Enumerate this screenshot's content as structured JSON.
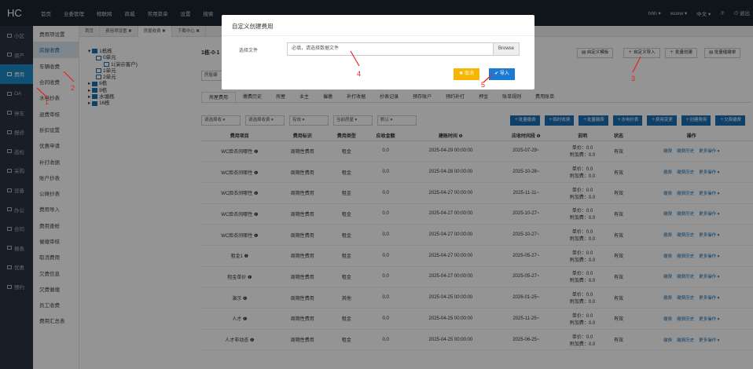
{
  "topbar": {
    "logo": "HC",
    "nav": [
      "首页",
      "业委管理",
      "物联网",
      "商城",
      "常用菜单",
      "设置",
      "搜索"
    ],
    "user": "hhh ▾",
    "community": "wuxw ▾",
    "lang": "中文 ▾",
    "help_icon": "⑦",
    "logout": "退出"
  },
  "sidebar": {
    "items": [
      {
        "label": "小区",
        "active": false
      },
      {
        "label": "资产",
        "active": false
      },
      {
        "label": "费用",
        "active": true
      },
      {
        "label": "OA",
        "active": false
      },
      {
        "label": "停车",
        "active": false
      },
      {
        "label": "报修",
        "active": false
      },
      {
        "label": "巡检",
        "active": false
      },
      {
        "label": "采购",
        "active": false
      },
      {
        "label": "设备",
        "active": false
      },
      {
        "label": "办公",
        "active": false
      },
      {
        "label": "合同",
        "active": false
      },
      {
        "label": "报表",
        "active": false
      },
      {
        "label": "优惠",
        "active": false
      },
      {
        "label": "预约",
        "active": false
      }
    ]
  },
  "submenu": {
    "items": [
      {
        "label": "费用项设置",
        "active": false
      },
      {
        "label": "房屋收费",
        "active": true
      },
      {
        "label": "车辆收费",
        "active": false
      },
      {
        "label": "合同收费",
        "active": false
      },
      {
        "label": "水电抄表",
        "active": false
      },
      {
        "label": "退费审核",
        "active": false
      },
      {
        "label": "折扣设置",
        "active": false
      },
      {
        "label": "优惠申请",
        "active": false
      },
      {
        "label": "补打收据",
        "active": false
      },
      {
        "label": "账户抄表",
        "active": false
      },
      {
        "label": "公摊抄表",
        "active": false
      },
      {
        "label": "费用导入",
        "active": false
      },
      {
        "label": "费用查帐",
        "active": false
      },
      {
        "label": "催缴审核",
        "active": false
      },
      {
        "label": "取消费用",
        "active": false
      },
      {
        "label": "欠费信息",
        "active": false
      },
      {
        "label": "欠费催缴",
        "active": false
      },
      {
        "label": "员工收费",
        "active": false
      },
      {
        "label": "费用汇总表",
        "active": false
      }
    ]
  },
  "tabs": [
    {
      "label": "首页",
      "active": false
    },
    {
      "label": "费用项设置  ✖",
      "active": false
    },
    {
      "label": "房屋收费  ✖",
      "active": true
    },
    {
      "label": "下载中心  ✖",
      "active": false
    }
  ],
  "tree": [
    {
      "label": "1栋栋",
      "indent": 0,
      "type": "folder"
    },
    {
      "label": "0单元",
      "indent": 1,
      "type": "unit"
    },
    {
      "label": "1(演示客户)",
      "indent": 2,
      "type": "room"
    },
    {
      "label": "1单元",
      "indent": 1,
      "type": "unit"
    },
    {
      "label": "2单元",
      "indent": 1,
      "type": "unit"
    },
    {
      "label": "6栋",
      "indent": 0,
      "type": "folder"
    },
    {
      "label": "9栋",
      "indent": 0,
      "type": "folder"
    },
    {
      "label": "水塘栋",
      "indent": 0,
      "type": "folder"
    },
    {
      "label": "16栋",
      "indent": 0,
      "type": "folder"
    }
  ],
  "content": {
    "title": "1栋-0-1",
    "room_field": "房屋编",
    "right_buttons": [
      "自定义模板",
      "自定义导入",
      "批量创建",
      "批量催缴单"
    ],
    "subtabs": [
      "房屋费用",
      "缴费历史",
      "房屋",
      "业主",
      "催缴",
      "补打收据",
      "抄表记录",
      "预存账户",
      "预约补打",
      "押金",
      "账单规则",
      "费用账单"
    ],
    "filters": [
      "请选择收 ▾",
      "请选择收费 ▾",
      "有效 ▾",
      "当前房屋 ▾",
      "默认 ▾"
    ],
    "action_buttons": [
      "批量缴费",
      "临时收费",
      "批量缴费",
      "水电抄表",
      "费用变更",
      "创建费用",
      "欠费缴费"
    ],
    "columns": [
      "费用项目",
      "费用标识",
      "费用类型",
      "应收金额",
      "建账时间 ❶",
      "应收时间段 ❶",
      "说明",
      "状态",
      "操作"
    ],
    "rows": [
      {
        "name": "WC脸衣间哪性 ❶",
        "flag": "周期性费用",
        "type": "租金",
        "amount": "0.0",
        "created": "2025-04-29 00:00:00",
        "period": "2025-07-29~",
        "desc": "单价：0.0\n附加费：0.0",
        "status": "有效"
      },
      {
        "name": "WC脸衣间哪性 ❶",
        "flag": "周期性费用",
        "type": "租金",
        "amount": "0.0",
        "created": "2025-04-28 00:00:00",
        "period": "2025-10-28~",
        "desc": "单价：0.0\n附加费：0.0",
        "status": "有效"
      },
      {
        "name": "WC脸衣间哪性 ❶",
        "flag": "周期性费用",
        "type": "租金",
        "amount": "0.0",
        "created": "2025-04-27 00:00:00",
        "period": "2025-11-11~",
        "desc": "单价：0.0\n附加费：0.0",
        "status": "有效"
      },
      {
        "name": "WC脸衣间哪性 ❶",
        "flag": "周期性费用",
        "type": "租金",
        "amount": "0.0",
        "created": "2025-04-27 00:00:00",
        "period": "2025-10-27~",
        "desc": "单价：0.0\n附加费：0.0",
        "status": "有效"
      },
      {
        "name": "WC脸衣间哪性 ❶",
        "flag": "周期性费用",
        "type": "租金",
        "amount": "0.0",
        "created": "2025-04-27 00:00:00",
        "period": "2025-10-27~",
        "desc": "单价：0.0\n附加费：0.0",
        "status": "有效"
      },
      {
        "name": "租金1 ❶",
        "flag": "周期性费用",
        "type": "租金",
        "amount": "0.0",
        "created": "2025-04-27 00:00:00",
        "period": "2025-05-27~",
        "desc": "单价：0.0\n附加费：0.0",
        "status": "有效"
      },
      {
        "name": "租金单价 ❶",
        "flag": "周期性费用",
        "type": "租金",
        "amount": "0.0",
        "created": "2025-04-27 00:00:00",
        "period": "2025-05-27~",
        "desc": "单价：0.0\n附加费：0.0",
        "status": "有效"
      },
      {
        "name": "演示 ❶",
        "flag": "周期性费用",
        "type": "其他",
        "amount": "0.0",
        "created": "2025-04-25 00:00:00",
        "period": "2026-01-25~",
        "desc": "单价：0.0\n附加费：0.0",
        "status": "有效"
      },
      {
        "name": "人才 ❶",
        "flag": "周期性费用",
        "type": "租金",
        "amount": "0.0",
        "created": "2025-04-25 00:00:00",
        "period": "2025-11-25~",
        "desc": "单价：0.0\n附加费：0.0",
        "status": "有效"
      },
      {
        "name": "人才非动态 ❶",
        "flag": "周期性费用",
        "type": "租金",
        "amount": "0.0",
        "created": "2025-04-25 00:00:00",
        "period": "2025-06-25~",
        "desc": "单价：0.0\n附加费：0.0",
        "status": "有效"
      }
    ],
    "row_ops": [
      "缴费",
      "缴费历史",
      "更多操作 ▾"
    ]
  },
  "modal": {
    "title": "自定义创建费用",
    "file_label": "选择文件",
    "file_placeholder": "必填，请选择数据文件",
    "browse": "Browse",
    "cancel": "✖ 取消",
    "ok": "✔ 导入"
  },
  "annotations": {
    "n1": "1",
    "n2": "2",
    "n3": "3",
    "n4": "4",
    "n5": "5"
  },
  "colors": {
    "accent": "#1a6fb5",
    "sidebar": "#2a3442",
    "topbar": "#1d2530",
    "warning": "#f7b500",
    "annotation": "#e8231a"
  }
}
